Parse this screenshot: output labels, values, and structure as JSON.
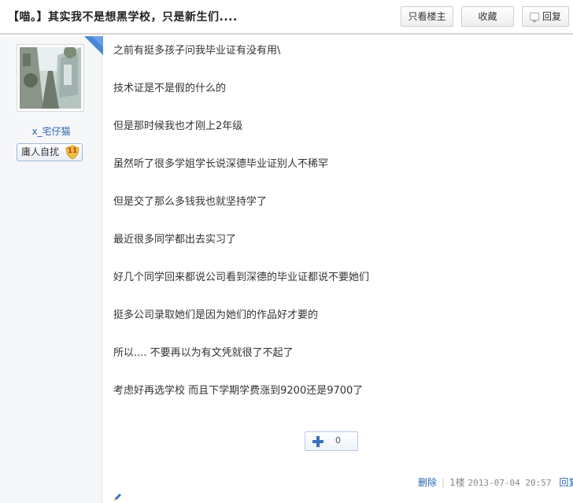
{
  "header": {
    "title": "【喵。】其实我不是想黑学校，只是新生们....",
    "only_op_label": "只看楼主",
    "favorite_label": "收藏",
    "reply_label": "回复"
  },
  "author": {
    "username": "x_宅仔猫",
    "title_badge": "庸人自扰",
    "level": "11"
  },
  "post": {
    "lines": [
      "之前有挺多孩子问我毕业证有没有用\\",
      "技术证是不是假的什么的",
      "但是那时候我也才刚上2年级",
      "虽然听了很多学姐学长说深德毕业证别人不稀罕",
      "但是交了那么多钱我也就坚持学了",
      "最近很多同学都出去实习了",
      "好几个同学回来都说公司看到深德的毕业证都说不要她们",
      "挺多公司录取她们是因为她们的作品好才要的",
      "所以.... 不要再以为有文凭就很了不起了",
      "考虑好再选学校 而且下学期学费涨到9200还是9700了"
    ],
    "like_count": "0"
  },
  "footer": {
    "delete_label": "删除",
    "floor": "1楼",
    "date": "2013-07-04 20:57",
    "reply_label": "回复"
  },
  "colors": {
    "link": "#2d64b3",
    "corner": "#4a86d8",
    "level_badge": "#f0c040"
  },
  "icons": [
    "reply-bubble-icon",
    "level-shield-icon",
    "corner-ribbon-icon",
    "plus-icon",
    "pencil-icon"
  ]
}
